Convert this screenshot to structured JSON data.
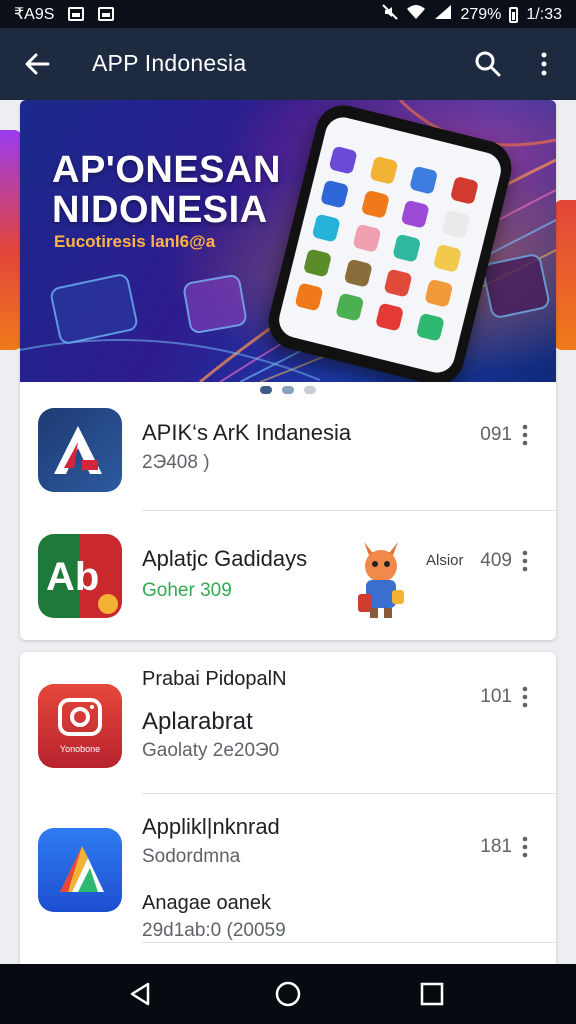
{
  "status_bar": {
    "left_text": "₹A9S",
    "battery": "279%",
    "time": "1/:33"
  },
  "app_bar": {
    "title": "APP Indonesia"
  },
  "banner": {
    "headline_line1": "AP'ONESAN",
    "headline_line2": "NIDONESIA",
    "subtitle": "Eucotiresis lanl6@a",
    "carousel_pages": 3,
    "carousel_active": 1
  },
  "list": [
    {
      "name": "APIK‘s ArK Indanesia",
      "meta": "2Э408 )",
      "count": "091",
      "icon": "apik-logo-icon"
    },
    {
      "name": "Aplatjc Gadidays",
      "meta": "Goher 309",
      "count": "409",
      "tag": "Alsior",
      "icon": "ab-logo-icon"
    }
  ],
  "list2": [
    {
      "header": "Prabai PidopalN",
      "name": "Aplarabrat",
      "meta": "Gaolaty 2e20Э0",
      "count": "101",
      "icon": "camera-icon",
      "icon_label": "Yonobone"
    },
    {
      "name": "Applikl|nknrad",
      "meta": "Sodordmna",
      "count": "181",
      "icon": "triangle-logo-icon",
      "extra_name": "Anagae oanek",
      "extra_meta": "29d1ab:0 (20059"
    }
  ],
  "colors": {
    "app_bar": "#1d2a40",
    "status_bar": "#0b0f17",
    "accent_green": "#34a853"
  }
}
